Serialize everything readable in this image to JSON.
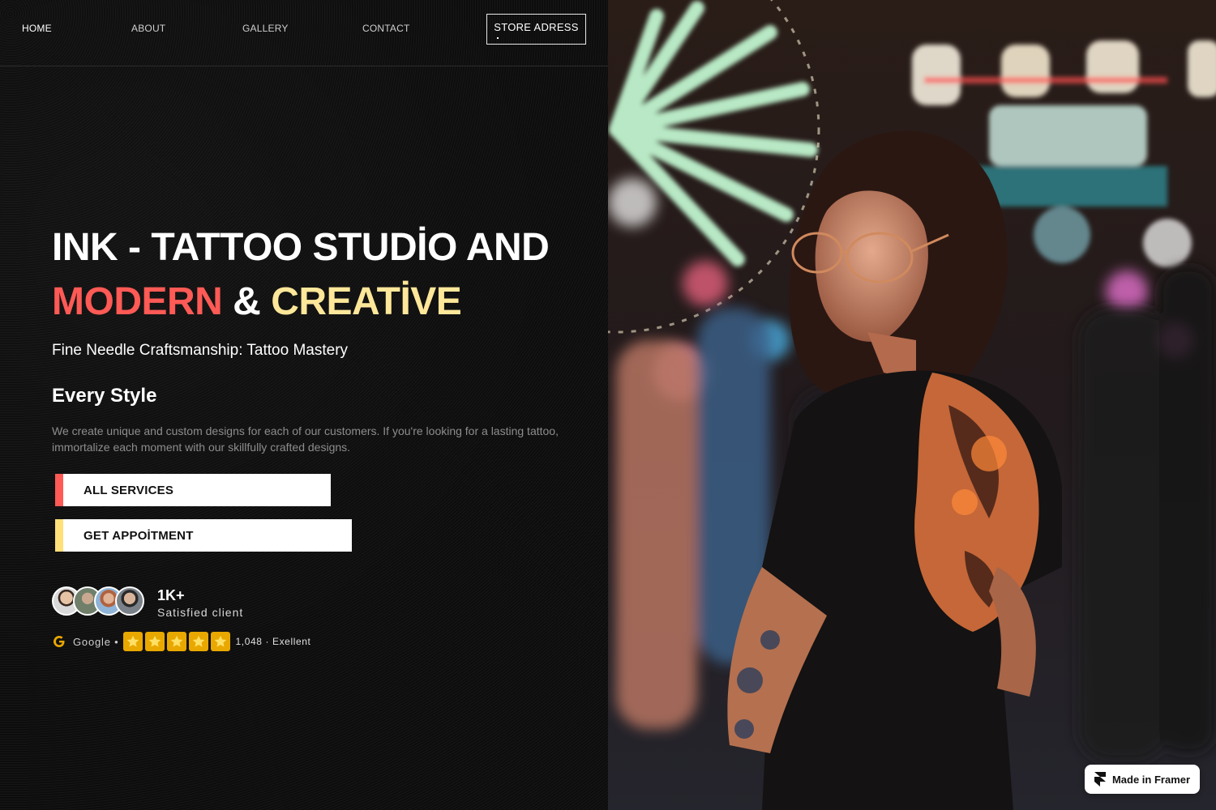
{
  "nav": {
    "items": [
      {
        "label": "HOME"
      },
      {
        "label": "ABOUT"
      },
      {
        "label": "GALLERY"
      },
      {
        "label": "CONTACT"
      }
    ],
    "store_button": "STORE ADRESS"
  },
  "hero": {
    "title_line1": "INK - TATTOO STUDİO AND",
    "title_word_red": "MODERN",
    "title_amp": "&",
    "title_word_yellow": "CREATİVE",
    "subtitle": "Fine Needle Craftsmanship: Tattoo Mastery",
    "heading": "Every Style",
    "description": "We create unique and custom designs for each of our customers. If you're looking for a lasting tattoo, immortalize each moment with our skillfully crafted designs."
  },
  "buttons": {
    "all_services": "ALL SERVICES",
    "get_appointment": "GET APPOİTMENT"
  },
  "social_proof": {
    "count": "1K+",
    "label": "Satisfied client",
    "source": "Google •",
    "stars": 5,
    "reviews": "1,048 · Exellent"
  },
  "badge": {
    "label": "Made in Framer"
  },
  "colors": {
    "accent_red": "#ff5a55",
    "accent_yellow": "#ffe79a",
    "star": "#e9a800"
  },
  "icons": {
    "google": "google-g-icon",
    "star": "star-icon",
    "framer": "framer-logo-icon"
  }
}
